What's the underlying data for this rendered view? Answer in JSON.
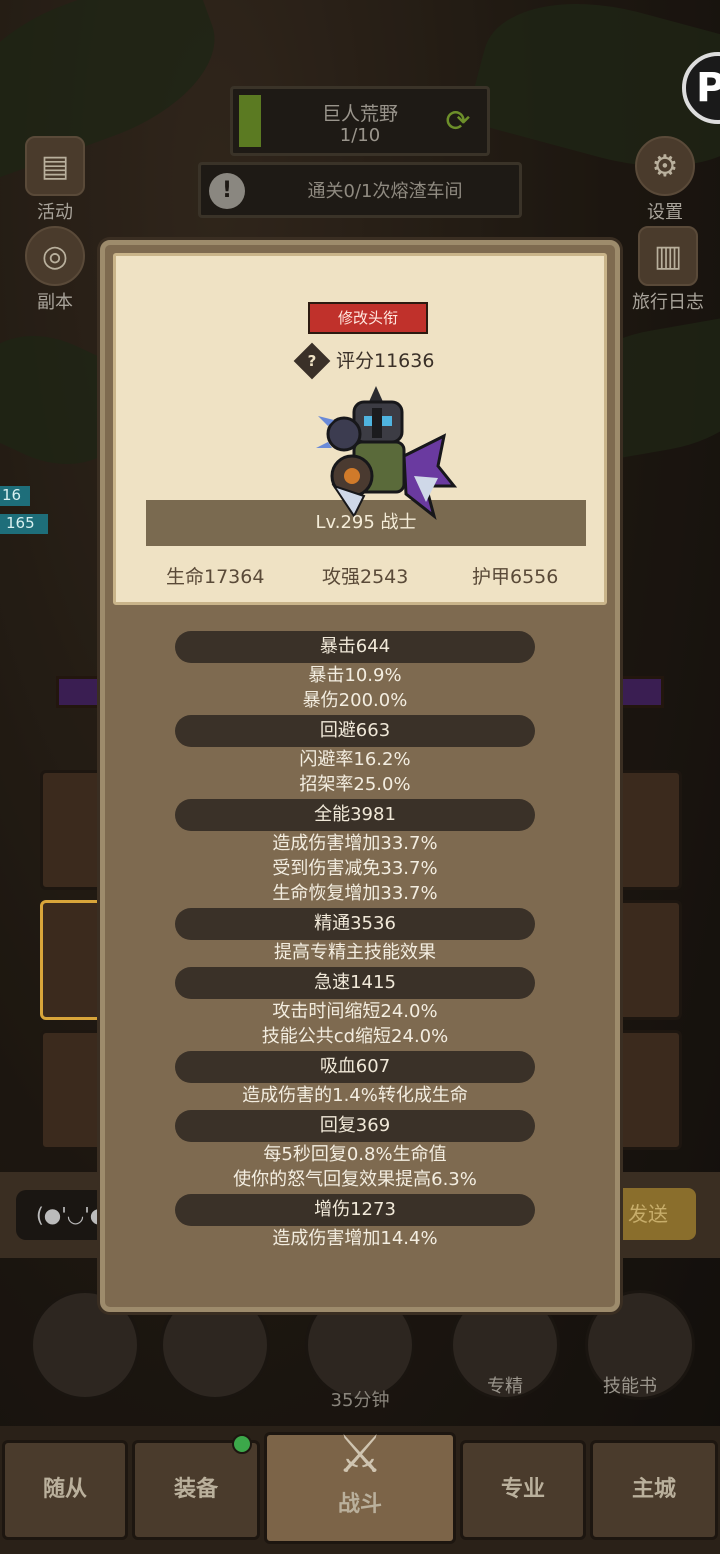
{
  "stage": {
    "name": "巨人荒野",
    "progress": "1/10",
    "progress_fraction": 0.1
  },
  "quest": {
    "text": "通关0/1次熔渣车间"
  },
  "side_left": [
    {
      "label": "活动"
    },
    {
      "label": "副本"
    }
  ],
  "side_right": [
    {
      "label": "设置"
    },
    {
      "label": "旅行日志"
    }
  ],
  "partial_numbers": [
    "16",
    "165"
  ],
  "panel": {
    "rename_button": "修改头衔",
    "score": "评分11636",
    "level_class": "Lv.295 战士",
    "base_stats": [
      "生命17364",
      "攻强2543",
      "护甲6556"
    ],
    "stats": [
      {
        "header": "暴击644",
        "lines": [
          "暴击10.9%",
          "暴伤200.0%"
        ]
      },
      {
        "header": "回避663",
        "lines": [
          "闪避率16.2%",
          "招架率25.0%"
        ]
      },
      {
        "header": "全能3981",
        "lines": [
          "造成伤害增加33.7%",
          "受到伤害减免33.7%",
          "生命恢复增加33.7%"
        ]
      },
      {
        "header": "精通3536",
        "lines": [
          "提高专精主技能效果"
        ]
      },
      {
        "header": "急速1415",
        "lines": [
          "攻击时间缩短24.0%",
          "技能公共cd缩短24.0%"
        ]
      },
      {
        "header": "吸血607",
        "lines": [
          "造成伤害的1.4%转化成生命"
        ]
      },
      {
        "header": "回复369",
        "lines": [
          "每5秒回复0.8%生命值",
          "使你的怒气回复效果提高6.3%"
        ]
      },
      {
        "header": "增伤1273",
        "lines": [
          "造成伤害增加14.4%"
        ]
      }
    ]
  },
  "chat": {
    "bubble": "(●'◡'●",
    "send": "发送"
  },
  "action_slots": {
    "timer": "35分钟",
    "specialization": "专精",
    "skill_book": "技能书"
  },
  "tabs": [
    {
      "label": "随从"
    },
    {
      "label": "装备",
      "badge": true
    },
    {
      "label": "战斗",
      "active": true
    },
    {
      "label": "专业"
    },
    {
      "label": "主城"
    }
  ]
}
